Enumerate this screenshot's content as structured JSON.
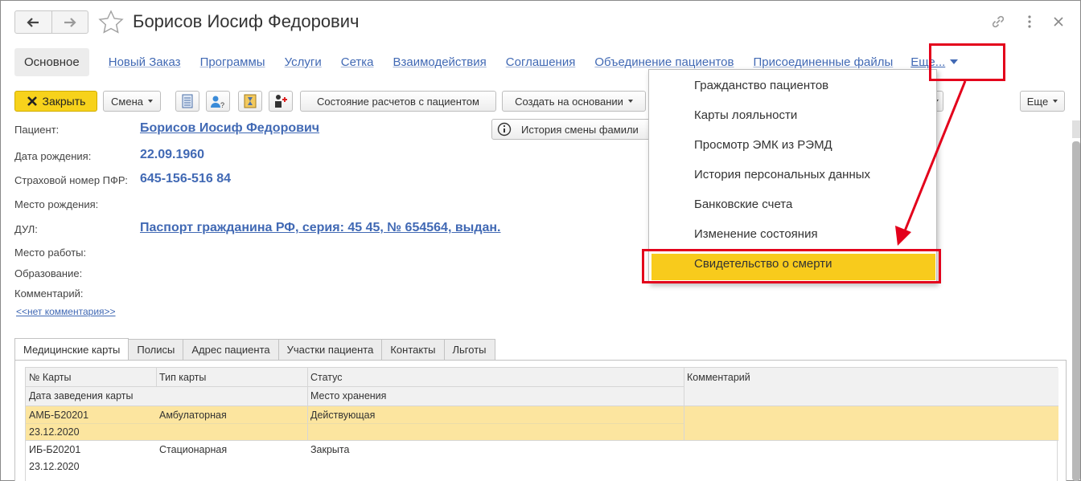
{
  "window": {
    "title": "Борисов Иосиф Федорович"
  },
  "sections": {
    "main": "Основное",
    "links": [
      "Новый Заказ",
      "Программы",
      "Услуги",
      "Сетка",
      "Взаимодействия",
      "Соглашения",
      "Объединение пациентов",
      "Присоединенные файлы"
    ],
    "more": "Еще..."
  },
  "toolbar": {
    "close": "Закрыть",
    "shift": "Смена",
    "settlement": "Состояние расчетов с пациентом",
    "create_based": "Создать на основании",
    "more": "Еще",
    "history": "История смены фамили"
  },
  "fields": {
    "patient_label": "Пациент:",
    "patient_value": "Борисов Иосиф Федорович",
    "dob_label": "Дата рождения:",
    "dob_value": "22.09.1960",
    "snils_label": "Страховой номер ПФР:",
    "snils_value": "645-156-516 84",
    "birthplace_label": "Место рождения:",
    "dul_label": "ДУЛ:",
    "dul_value": "Паспорт гражданина РФ, серия: 45 45, № 654564, выдан.",
    "work_label": "Место работы:",
    "education_label": "Образование:",
    "comment_label": "Комментарий:",
    "comment_link": "<<нет комментария>>"
  },
  "tabs": [
    "Медицинские карты",
    "Полисы",
    "Адрес пациента",
    "Участки пациента",
    "Контакты",
    "Льготы"
  ],
  "table": {
    "headers": {
      "card_no": "№ Карты",
      "card_type": "Тип карты",
      "status": "Статус",
      "comment": "Комментарий",
      "date_created": "Дата заведения карты",
      "storage": "Место хранения"
    },
    "rows": [
      {
        "card_no": "АМБ-Б20201",
        "card_type": "Амбулаторная",
        "status": "Действующая",
        "date": "23.12.2020",
        "selected": true
      },
      {
        "card_no": "ИБ-Б20201",
        "card_type": "Стационарная",
        "status": "Закрыта",
        "date": "23.12.2020",
        "selected": false
      }
    ]
  },
  "dropdown": {
    "items": [
      "Гражданство пациентов",
      "Карты лояльности",
      "Просмотр ЭМК из РЭМД",
      "История персональных данных",
      "Банковские счета",
      "Изменение состояния",
      "Свидетельство о смерти"
    ],
    "selected_index": 6
  },
  "colors": {
    "link": "#4169b4",
    "highlight": "#f8cb1c",
    "selected_row": "#fce59f",
    "annotation": "#e3001b"
  }
}
